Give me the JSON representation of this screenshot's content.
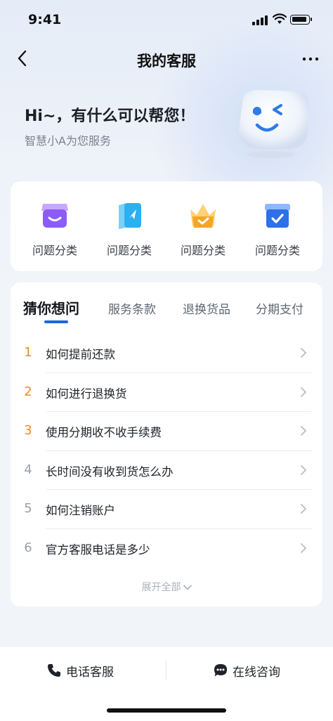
{
  "status_bar": {
    "time": "9:41"
  },
  "nav": {
    "title": "我的客服"
  },
  "greeting": {
    "title": "Hi~，有什么可以帮您！",
    "subtitle": "智慧小A为您服务"
  },
  "categories": [
    {
      "label": "问题分类",
      "icon": "storefront-icon",
      "color": "#8b5cf6"
    },
    {
      "label": "问题分类",
      "icon": "map-guide-icon",
      "color": "#2bb0f0"
    },
    {
      "label": "问题分类",
      "icon": "crown-icon",
      "color": "#f5a623"
    },
    {
      "label": "问题分类",
      "icon": "checked-box-icon",
      "color": "#2f6fe8"
    }
  ],
  "faq": {
    "tabs": [
      "猜你想问",
      "服务条款",
      "退换货品",
      "分期支付"
    ],
    "active_tab": 0,
    "items": [
      {
        "num": "1",
        "text": "如何提前还款",
        "hot": true
      },
      {
        "num": "2",
        "text": "如何进行退换货",
        "hot": true
      },
      {
        "num": "3",
        "text": "使用分期收不收手续费",
        "hot": true
      },
      {
        "num": "4",
        "text": "长时间没有收到货怎么办",
        "hot": false
      },
      {
        "num": "5",
        "text": "如何注销账户",
        "hot": false
      },
      {
        "num": "6",
        "text": "官方客服电话是多少",
        "hot": false
      }
    ],
    "expand_label": "展开全部"
  },
  "bottom_bar": {
    "phone_label": "电话客服",
    "online_label": "在线咨询"
  },
  "colors": {
    "accent": "#1a66e0",
    "hot_number": "#f08a1c",
    "normal_number": "#9aa1ab"
  }
}
